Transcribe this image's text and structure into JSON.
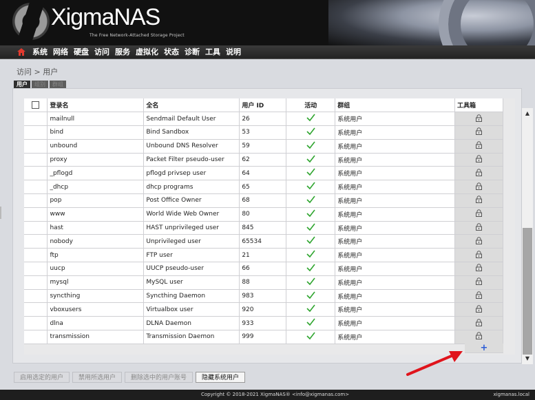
{
  "brand": {
    "name": "XigmaNAS",
    "tagline": "The Free Network-Attached Storage Project",
    "logo_icon": "xigmanas-ring-logo"
  },
  "menu": {
    "home_icon": "home-icon",
    "items": [
      "系统",
      "网络",
      "硬盘",
      "访问",
      "服务",
      "虚拟化",
      "状态",
      "诊断",
      "工具",
      "说明"
    ]
  },
  "breadcrumb": "访问 > 用户",
  "tabs": [
    {
      "label": "用户",
      "active": true
    },
    {
      "label": "组别",
      "active": false
    },
    {
      "label": "群组",
      "active": false
    }
  ],
  "table": {
    "headers": {
      "login": "登录名",
      "fullname": "全名",
      "uid": "用户 ID",
      "active": "活动",
      "group": "群组",
      "toolbox": "工具箱"
    },
    "rows": [
      {
        "login": "mailnull",
        "fullname": "Sendmail Default User",
        "uid": "26",
        "group": "系统用户"
      },
      {
        "login": "bind",
        "fullname": "Bind Sandbox",
        "uid": "53",
        "group": "系统用户"
      },
      {
        "login": "unbound",
        "fullname": "Unbound DNS Resolver",
        "uid": "59",
        "group": "系统用户"
      },
      {
        "login": "proxy",
        "fullname": "Packet Filter pseudo-user",
        "uid": "62",
        "group": "系统用户"
      },
      {
        "login": "_pflogd",
        "fullname": "pflogd privsep user",
        "uid": "64",
        "group": "系统用户"
      },
      {
        "login": "_dhcp",
        "fullname": "dhcp programs",
        "uid": "65",
        "group": "系统用户"
      },
      {
        "login": "pop",
        "fullname": "Post Office Owner",
        "uid": "68",
        "group": "系统用户"
      },
      {
        "login": "www",
        "fullname": "World Wide Web Owner",
        "uid": "80",
        "group": "系统用户"
      },
      {
        "login": "hast",
        "fullname": "HAST unprivileged user",
        "uid": "845",
        "group": "系统用户"
      },
      {
        "login": "nobody",
        "fullname": "Unprivileged user",
        "uid": "65534",
        "group": "系统用户"
      },
      {
        "login": "ftp",
        "fullname": "FTP user",
        "uid": "21",
        "group": "系统用户"
      },
      {
        "login": "uucp",
        "fullname": "UUCP pseudo-user",
        "uid": "66",
        "group": "系统用户"
      },
      {
        "login": "mysql",
        "fullname": "MySQL user",
        "uid": "88",
        "group": "系统用户"
      },
      {
        "login": "syncthing",
        "fullname": "Syncthing Daemon",
        "uid": "983",
        "group": "系统用户"
      },
      {
        "login": "vboxusers",
        "fullname": "Virtualbox user",
        "uid": "920",
        "group": "系统用户"
      },
      {
        "login": "dlna",
        "fullname": "DLNA Daemon",
        "uid": "933",
        "group": "系统用户"
      },
      {
        "login": "transmission",
        "fullname": "Transmission Daemon",
        "uid": "999",
        "group": "系统用户"
      }
    ],
    "active_icon": "checkmark-icon",
    "tool_icon": "lock-icon",
    "add_icon": "plus-icon",
    "add_symbol": "+"
  },
  "buttons": [
    {
      "label": "启用选定的用户",
      "active": false
    },
    {
      "label": "禁用所选用户",
      "active": false
    },
    {
      "label": "删除选中的用户账号",
      "active": false
    },
    {
      "label": "隐藏系统用户",
      "active": true
    }
  ],
  "footer": {
    "copyright": "Copyright © 2018-2021 XigmaNAS® <info@xigmanas.com>",
    "hostname": "xigmanas.local"
  },
  "colors": {
    "accent_plus": "#2a5bd6",
    "check_green": "#2fa52f",
    "arrow_red": "#e0141c",
    "menubar": "#2b2b2b"
  }
}
